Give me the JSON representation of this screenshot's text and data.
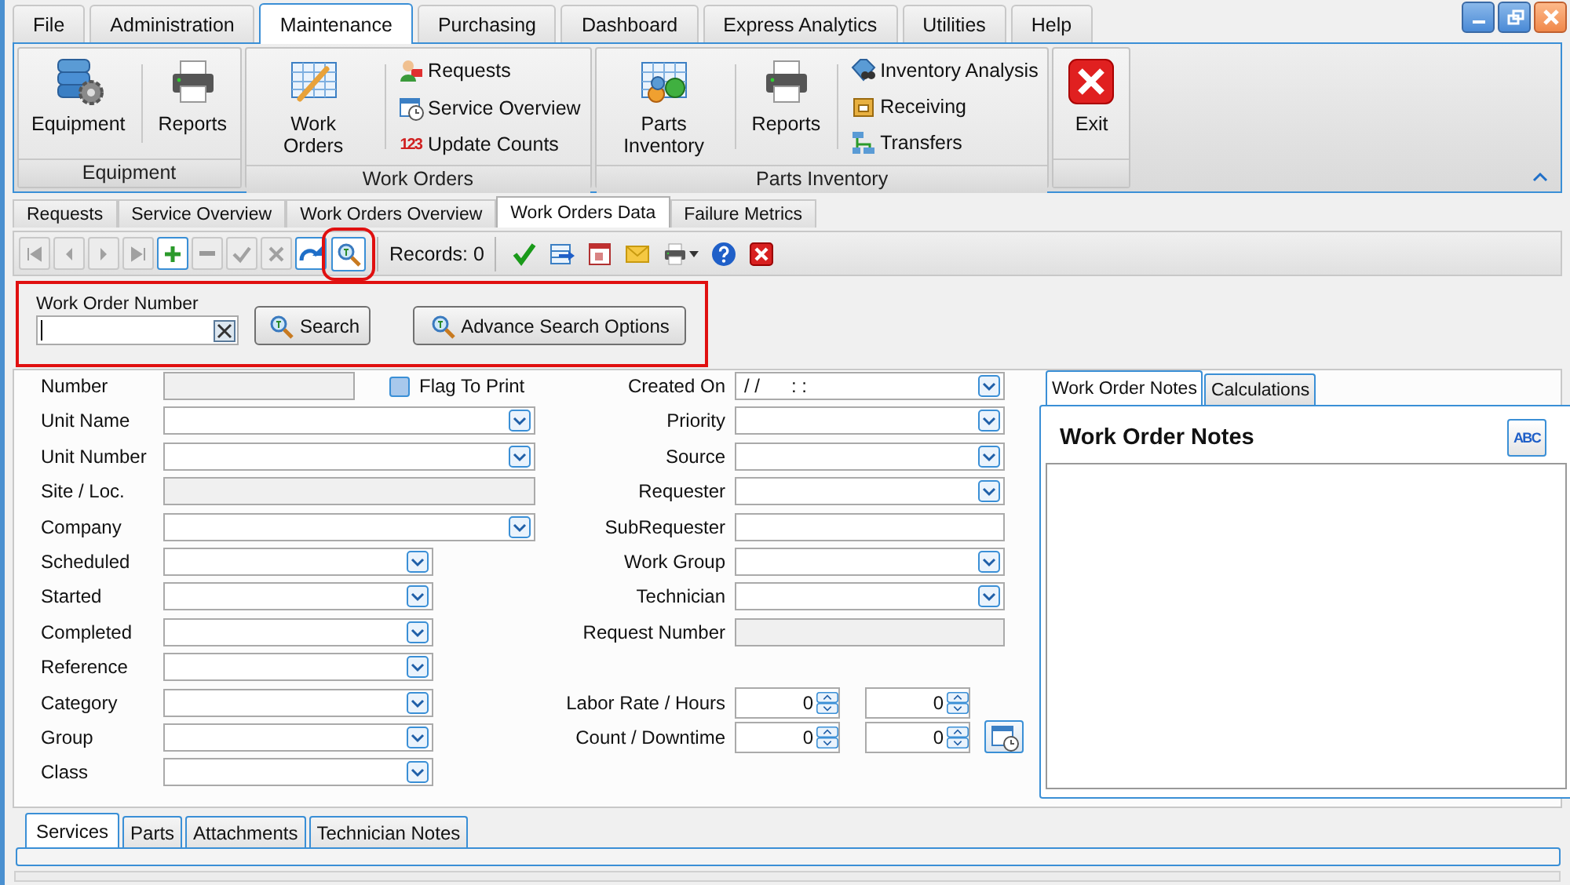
{
  "menu_tabs": [
    {
      "label": "File",
      "selected": false
    },
    {
      "label": "Administration",
      "selected": false
    },
    {
      "label": "Maintenance",
      "selected": true
    },
    {
      "label": "Purchasing",
      "selected": false
    },
    {
      "label": "Dashboard",
      "selected": false
    },
    {
      "label": "Express Analytics",
      "selected": false
    },
    {
      "label": "Utilities",
      "selected": false
    },
    {
      "label": "Help",
      "selected": false
    }
  ],
  "ribbon": {
    "groups": [
      {
        "caption": "Equipment",
        "items": [
          {
            "kind": "large",
            "label": "Equipment"
          },
          {
            "kind": "large",
            "label": "Reports"
          }
        ]
      },
      {
        "caption": "Work Orders",
        "items": [
          {
            "kind": "large",
            "label": "Work Orders"
          },
          {
            "kind": "stack",
            "entries": [
              {
                "label": "Requests"
              },
              {
                "label": "Service Overview"
              },
              {
                "label": "Update Counts",
                "icon_text": "123"
              }
            ]
          }
        ]
      },
      {
        "caption": "Parts Inventory",
        "items": [
          {
            "kind": "large",
            "label": "Parts Inventory"
          },
          {
            "kind": "large",
            "label": "Reports"
          },
          {
            "kind": "stack",
            "entries": [
              {
                "label": "Inventory Analysis"
              },
              {
                "label": "Receiving"
              },
              {
                "label": "Transfers"
              }
            ]
          }
        ]
      },
      {
        "items": [
          {
            "kind": "large",
            "label": "Exit"
          }
        ]
      }
    ]
  },
  "sub_tabs": [
    {
      "label": "Requests",
      "selected": false
    },
    {
      "label": "Service Overview",
      "selected": false
    },
    {
      "label": "Work Orders Overview",
      "selected": false
    },
    {
      "label": "Work Orders Data",
      "selected": true
    },
    {
      "label": "Failure Metrics",
      "selected": false
    }
  ],
  "toolbar": {
    "nav_buttons": [
      {
        "disabled": true
      },
      {
        "disabled": true
      },
      {
        "disabled": true
      },
      {
        "disabled": true
      },
      {
        "disabled": false
      },
      {
        "disabled": true
      },
      {
        "disabled": true
      },
      {
        "disabled": true
      },
      {
        "disabled": false
      }
    ],
    "search_button": {
      "disabled": false,
      "highlighted": true
    },
    "records": "Records: 0"
  },
  "search_panel": {
    "highlighted": true,
    "label": "Work Order Number",
    "buttons": [
      "Search",
      "Advance Search Options"
    ]
  },
  "form": {
    "flag": {
      "label": "Flag To Print",
      "checked": false
    },
    "left_fields": [
      {
        "label": "Number",
        "kind": "readonly",
        "wide": false
      },
      {
        "label": "Unit Name",
        "kind": "combo",
        "wide": true
      },
      {
        "label": "Unit Number",
        "kind": "combo",
        "wide": true
      },
      {
        "label": "Site / Loc.",
        "kind": "readonly",
        "wide": true
      },
      {
        "label": "Company",
        "kind": "combo",
        "wide": true
      },
      {
        "label": "Scheduled",
        "kind": "combo",
        "wide": false
      },
      {
        "label": "Started",
        "kind": "combo",
        "wide": false
      },
      {
        "label": "Completed",
        "kind": "combo",
        "wide": false
      },
      {
        "label": "Reference",
        "kind": "combo",
        "wide": false
      },
      {
        "label": "Category",
        "kind": "combo",
        "wide": false
      },
      {
        "label": "Group",
        "kind": "combo",
        "wide": false
      },
      {
        "label": "Class",
        "kind": "combo",
        "wide": false
      }
    ],
    "right_fields": [
      {
        "label": "Created On",
        "kind": "combo",
        "value": "/ /      : :"
      },
      {
        "label": "Priority",
        "kind": "combo"
      },
      {
        "label": "Source",
        "kind": "combo"
      },
      {
        "label": "Requester",
        "kind": "combo"
      },
      {
        "label": "SubRequester",
        "kind": "text"
      },
      {
        "label": "Work Group",
        "kind": "combo"
      },
      {
        "label": "Technician",
        "kind": "combo"
      },
      {
        "label": "Request Number",
        "kind": "readonly"
      }
    ],
    "measure_fields": [
      {
        "label": "Labor Rate / Hours",
        "values": [
          "0",
          "0"
        ],
        "has_button": false
      },
      {
        "label": "Count / Downtime",
        "values": [
          "0",
          "0"
        ],
        "has_button": true
      }
    ]
  },
  "notes": {
    "tabs": [
      {
        "label": "Work Order Notes",
        "selected": true
      },
      {
        "label": "Calculations",
        "selected": false
      }
    ],
    "title": "Work Order Notes",
    "spell_button": "ABC"
  },
  "bottom_tabs": [
    {
      "label": "Services",
      "selected": true
    },
    {
      "label": "Parts",
      "selected": false
    },
    {
      "label": "Attachments",
      "selected": false
    },
    {
      "label": "Technician Notes",
      "selected": false
    }
  ]
}
